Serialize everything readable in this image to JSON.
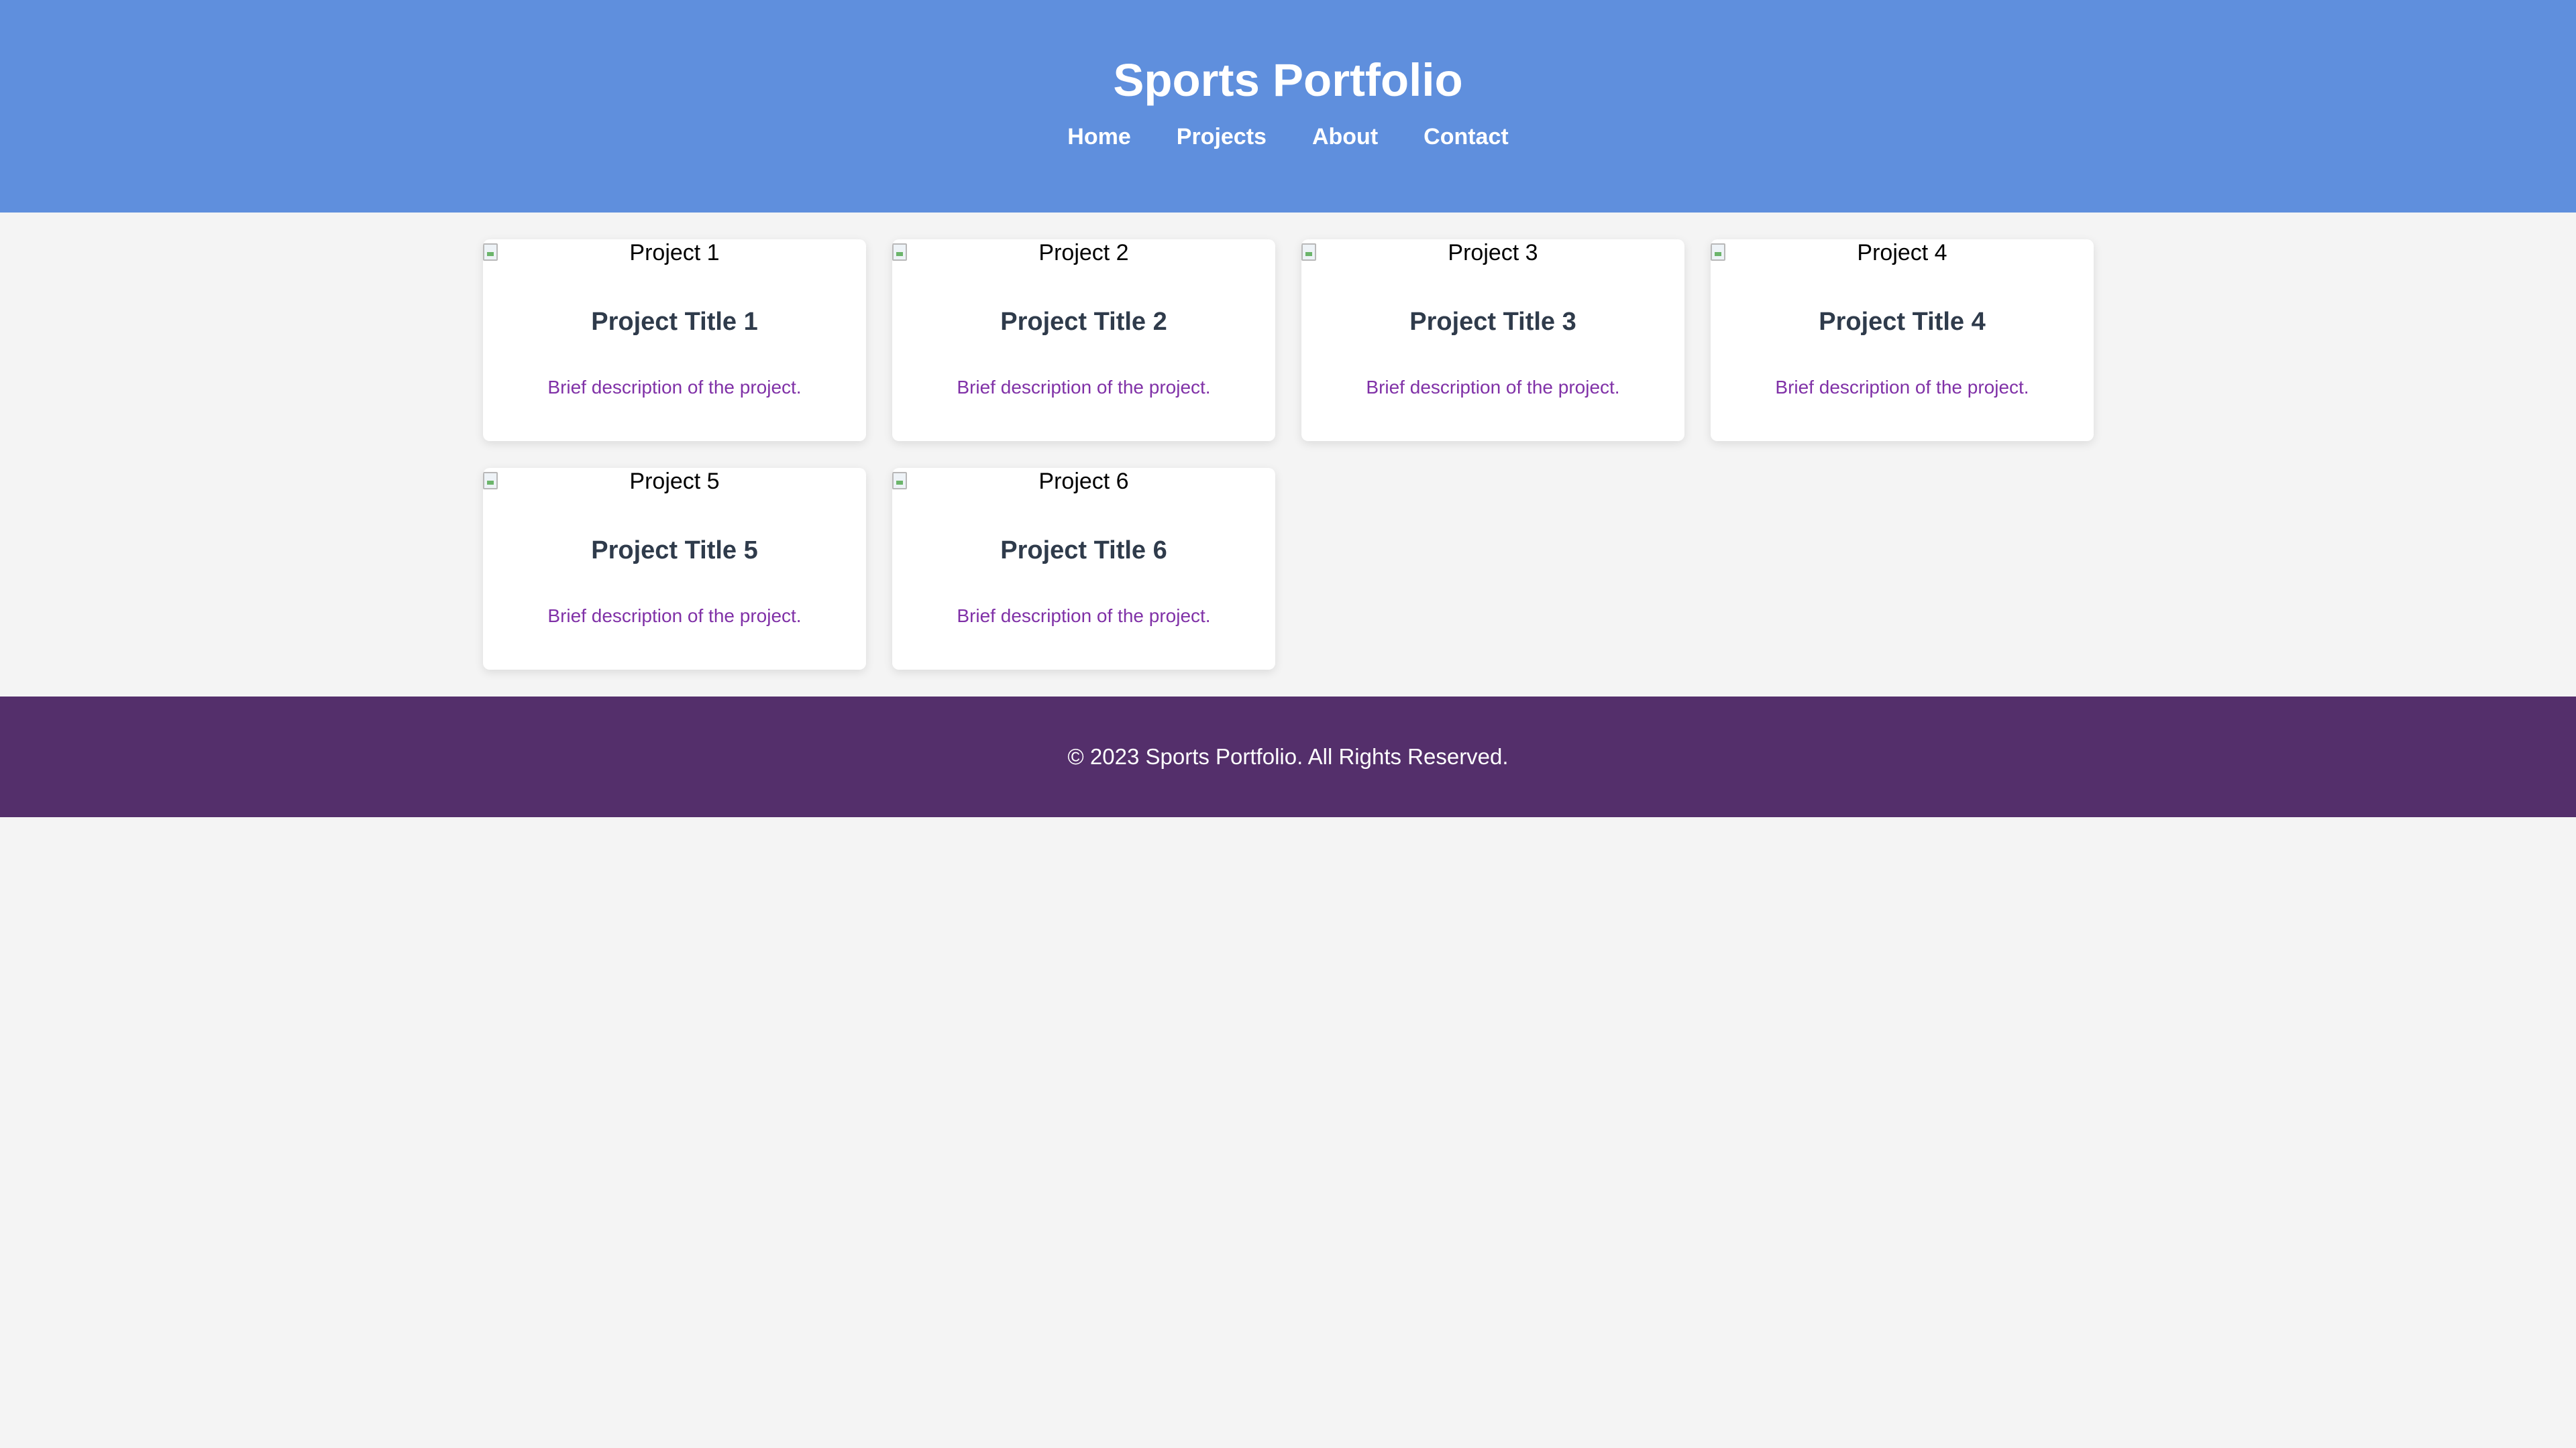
{
  "header": {
    "title": "Sports Portfolio",
    "nav": [
      {
        "label": "Home"
      },
      {
        "label": "Projects"
      },
      {
        "label": "About"
      },
      {
        "label": "Contact"
      }
    ]
  },
  "projects": [
    {
      "image_alt": "Project 1",
      "title": "Project Title 1",
      "description": "Brief description of the project."
    },
    {
      "image_alt": "Project 2",
      "title": "Project Title 2",
      "description": "Brief description of the project."
    },
    {
      "image_alt": "Project 3",
      "title": "Project Title 3",
      "description": "Brief description of the project."
    },
    {
      "image_alt": "Project 4",
      "title": "Project Title 4",
      "description": "Brief description of the project."
    },
    {
      "image_alt": "Project 5",
      "title": "Project Title 5",
      "description": "Brief description of the project."
    },
    {
      "image_alt": "Project 6",
      "title": "Project Title 6",
      "description": "Brief description of the project."
    }
  ],
  "footer": {
    "text": "© 2023 Sports Portfolio. All Rights Reserved."
  },
  "colors": {
    "header_bg": "#5f8fdd",
    "footer_bg": "#542f6b",
    "page_bg": "#f4f4f4",
    "card_title": "#2f3b4b",
    "card_desc": "#8031a7"
  },
  "icons": {
    "card_image": "broken-image-icon"
  }
}
